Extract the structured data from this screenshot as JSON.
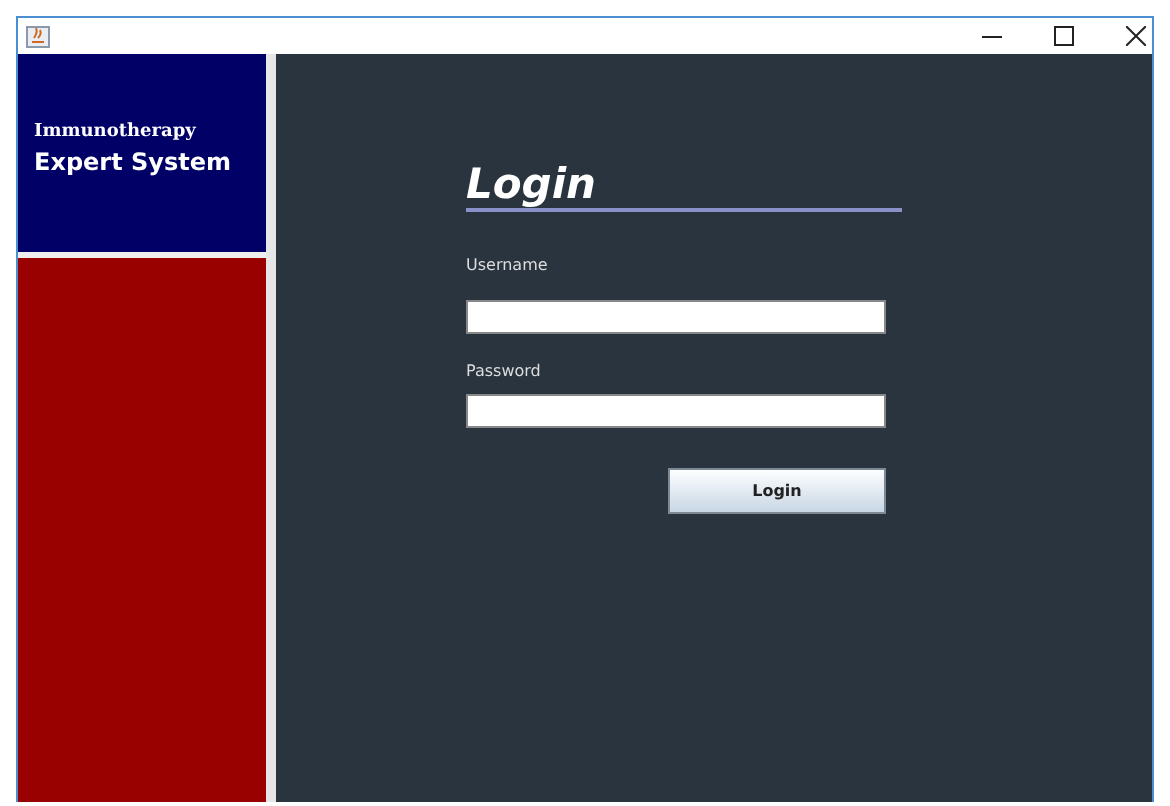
{
  "sidebar": {
    "subtitle": "Immunotherapy",
    "title": "Expert System"
  },
  "form": {
    "heading": "Login",
    "fields": [
      {
        "label": "Username"
      },
      {
        "label": "Password"
      }
    ],
    "button": "Login"
  }
}
